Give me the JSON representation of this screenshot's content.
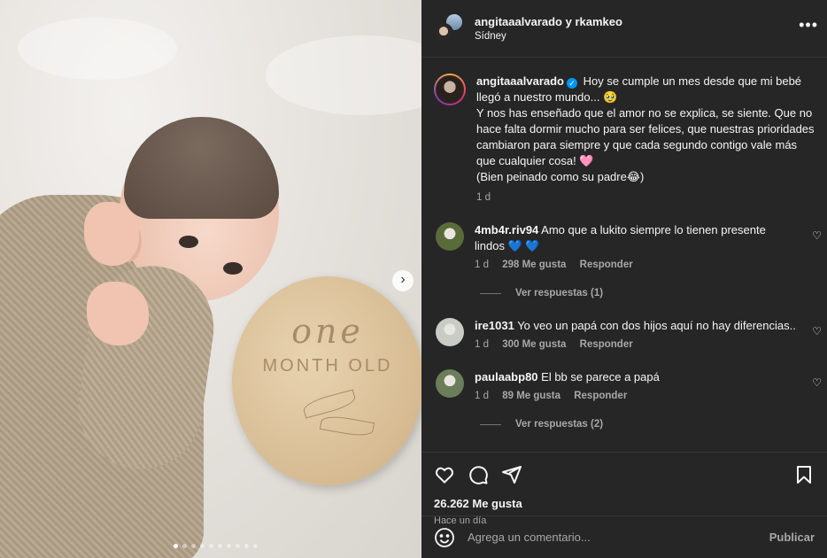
{
  "photo": {
    "plaque_line1": "one",
    "plaque_line2": "MONTH OLD",
    "carousel_count": 10,
    "carousel_active": 0
  },
  "header": {
    "title": "angitaaalvarado y rkamkeo",
    "location": "Sídney",
    "more_label": "•••"
  },
  "caption": {
    "username": "angitaaalvarado",
    "verified_glyph": "✓",
    "line1": " Hoy se cumple un mes desde que mi bebé llegó a nuestro mundo... 🥹",
    "line2": "Y nos has enseñado que el amor no se explica, se siente. Que no hace falta dormir mucho para ser felices, que nuestras prioridades cambiaron para siempre y que cada segundo contigo vale más que cualquier cosa! 🩷",
    "line3": "(Bien peinado como su padre😂)",
    "time": "1 d"
  },
  "comments": [
    {
      "username": "4mb4r.riv94",
      "text": " Amo que a lukito siempre lo tienen presente lindos 💙 💙",
      "time": "1 d",
      "likes": "298 Me gusta",
      "reply": "Responder",
      "view_replies": "Ver respuestas (1)",
      "avatar_color": "#5a6b3a"
    },
    {
      "username": "ire1031",
      "text": " Yo veo un papá con dos hijos aquí no hay diferencias..",
      "time": "1 d",
      "likes": "300 Me gusta",
      "reply": "Responder",
      "view_replies": "",
      "avatar_color": "#c9ccc4"
    },
    {
      "username": "paulaabp80",
      "text": " El bb se parece a papá",
      "time": "1 d",
      "likes": "89 Me gusta",
      "reply": "Responder",
      "view_replies": "Ver respuestas (2)",
      "avatar_color": "#6b7d5a"
    }
  ],
  "actions": {
    "likes": "26.262 Me gusta",
    "time_ago": "Hace un día"
  },
  "composer": {
    "placeholder": "Agrega un comentario...",
    "publish": "Publicar"
  },
  "colors": {
    "panel_bg": "#262626",
    "verified": "#0095f6",
    "muted_text": "#a8a8a8"
  }
}
